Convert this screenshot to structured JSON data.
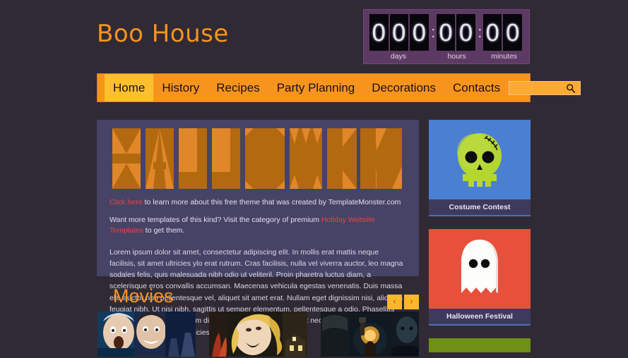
{
  "site": {
    "title": "Boo House",
    "background_color": "#302a35",
    "accent_color": "#f7941e",
    "panel_color": "#474366",
    "link_color": "#e8443f"
  },
  "countdown": {
    "digits": [
      "0",
      "0",
      "0",
      "0",
      "0",
      "0",
      "0"
    ],
    "separator": ":",
    "labels": {
      "days": "days",
      "hours": "hours",
      "minutes": "minutes"
    },
    "panel_color": "#5d3a63",
    "digit_color": "#07060a"
  },
  "nav": {
    "items": [
      {
        "label": "Home",
        "active": true
      },
      {
        "label": "History",
        "active": false
      },
      {
        "label": "Recipes",
        "active": false
      },
      {
        "label": "Party Planning",
        "active": false
      },
      {
        "label": "Decorations",
        "active": false
      },
      {
        "label": "Contacts",
        "active": false
      }
    ],
    "bar_color": "#f7941e",
    "active_color": "#fcc02e"
  },
  "search": {
    "value": "",
    "placeholder": "",
    "icon": "search-icon"
  },
  "banner": {
    "word": "HALLOWEEN",
    "style": "origami-block-letters",
    "fill_dark": "#b3690f",
    "fill_light": "#e0872a"
  },
  "promos": [
    {
      "link_text": "Click here",
      "rest": " to learn more about this free theme that was created by TemplateMonster.com"
    },
    {
      "prefix": "Want more templates of this kind? Visit the category of premium ",
      "link_text": "Holiday Website Templates",
      "suffix": " to get them."
    }
  ],
  "body_copy": "Lorem ipsum dolor sit amet, consectetur adipiscing elit. In mollis erat mattis neque facilisis, sit amet ultricies ylo erat rutrum. Cras facilisis, nulla vel viverra auctor, leo magna sodales felis, quis malesuada nibh odio ut veliteril. Proin pharetra luctus diam, a scelerisque eros convallis accumsan. Maecenas vehicula egestas venenatis. Duis massa elit, auctor non pellentesque vel, aliquet sit amet erat. Nullam eget dignissim nisi, aliquam feugiat nibh. Ut nisi nibh, sagittis ut semper elementum, pellentesque a odio. Phasellus vitae libero vel justo pretium dignissim. Integer semper in est nec congue. In laoreet lacus eros, vel pulvinar urna ultricies ut.",
  "movies": {
    "title": "Movies",
    "prev_label": "‹",
    "next_label": "›",
    "thumbnails": [
      {
        "name": "movie-poster-1",
        "alt": "Two frightened faces horror comedy poster"
      },
      {
        "name": "movie-poster-2",
        "alt": "Screaming blonde woman horror poster"
      },
      {
        "name": "movie-poster-3",
        "alt": "Dark figure with lantern horror poster"
      }
    ]
  },
  "sidebar": {
    "cards": [
      {
        "title": "Costume Contest",
        "icon": "skull-icon",
        "bg": "#4b7fd1",
        "icon_color": "#b4d631"
      },
      {
        "title": "Halloween Festival",
        "icon": "ghost-icon",
        "bg": "#e8503c",
        "icon_color": "#ffffff"
      }
    ],
    "next_card_color": "#6f8f16"
  }
}
